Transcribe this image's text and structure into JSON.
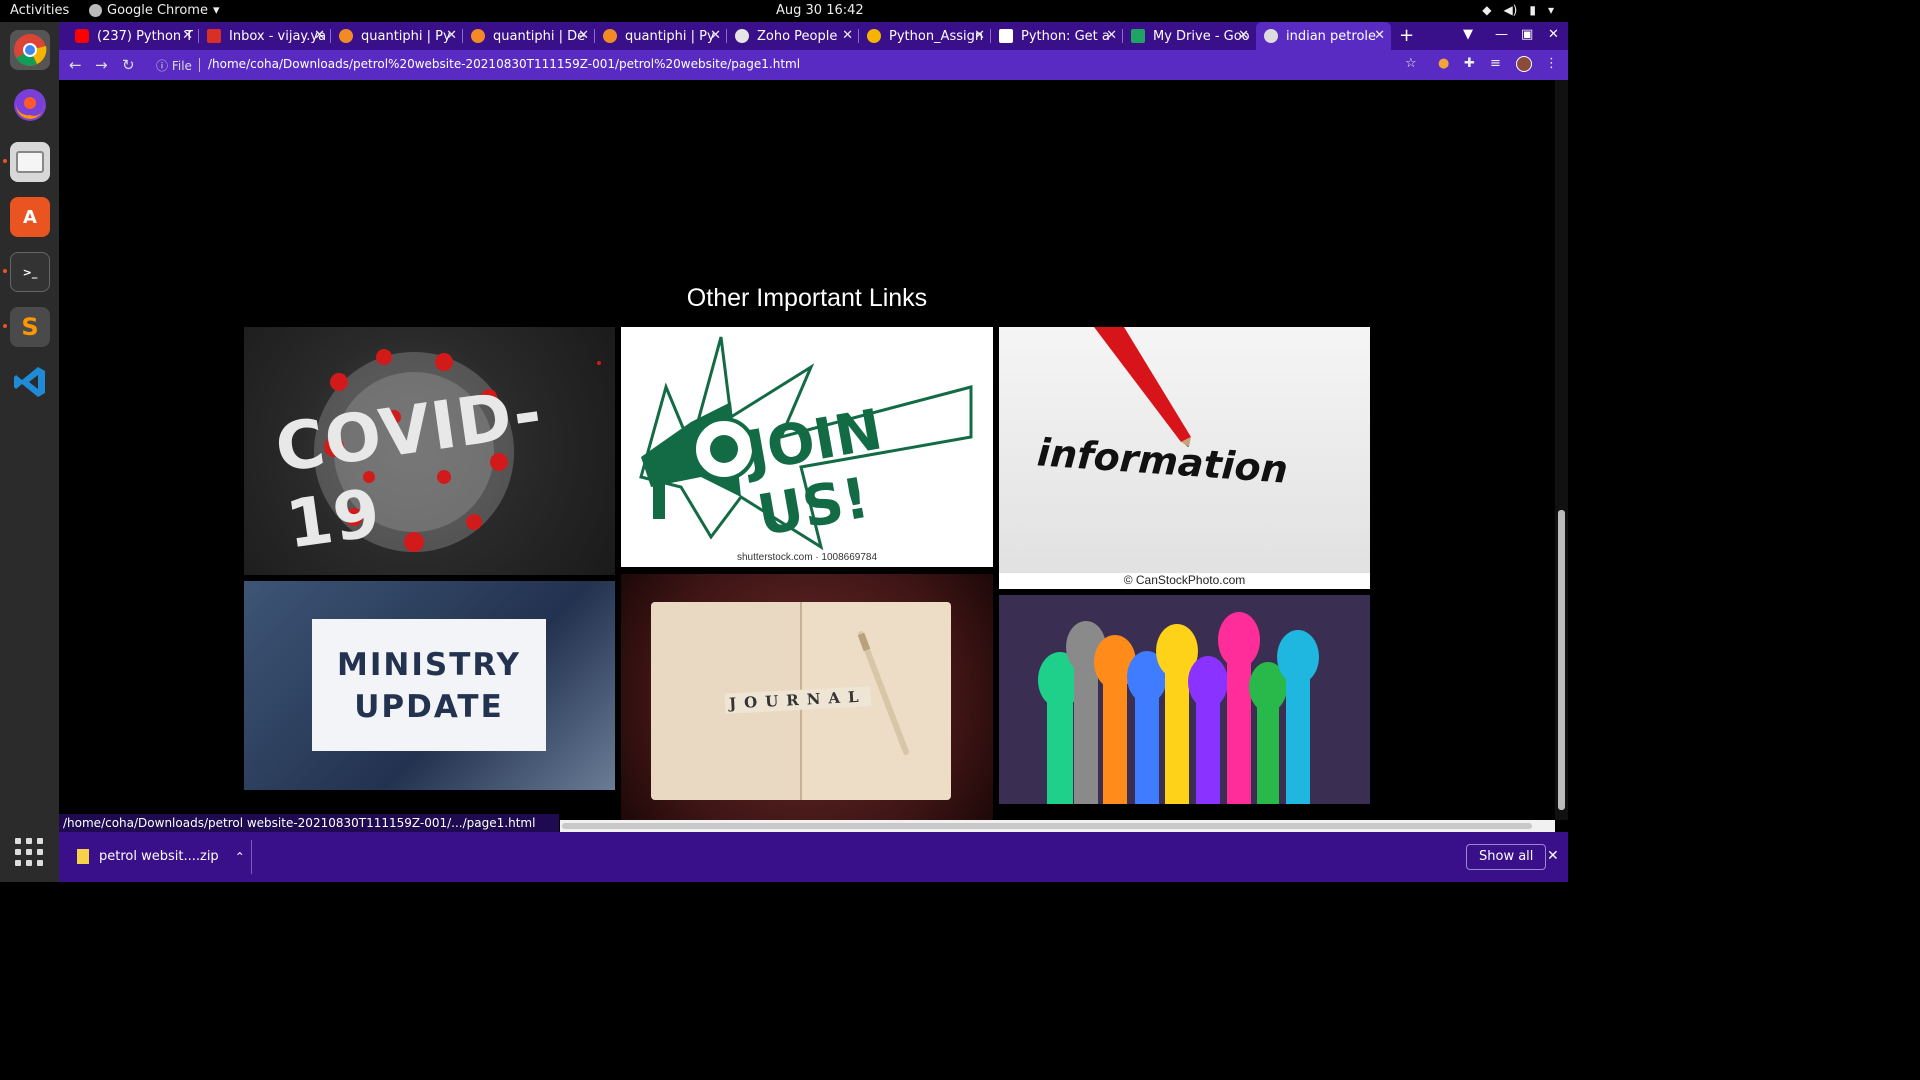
{
  "system": {
    "activities": "Activities",
    "app_name": "Google Chrome",
    "clock": "Aug 30  16:42"
  },
  "tabs": [
    {
      "title": "(237) Python T",
      "favicon_color": "#ff0000",
      "favicon": "youtube-icon"
    },
    {
      "title": "Inbox - vijay.ya",
      "favicon_color": "#d93025",
      "favicon": "gmail-icon"
    },
    {
      "title": "quantiphi | Py",
      "favicon_color": "#f28b25",
      "favicon": "quantiphi-icon"
    },
    {
      "title": "quantiphi | De",
      "favicon_color": "#f28b25",
      "favicon": "quantiphi-icon"
    },
    {
      "title": "quantiphi | Py",
      "favicon_color": "#f28b25",
      "favicon": "quantiphi-icon"
    },
    {
      "title": "Zoho People",
      "favicon_color": "#e5e5e5",
      "favicon": "zoho-icon"
    },
    {
      "title": "Python_Assign",
      "favicon_color": "#f4b400",
      "favicon": "colab-icon"
    },
    {
      "title": "Python: Get a",
      "favicon_color": "#ffffff",
      "favicon": "page-icon"
    },
    {
      "title": "My Drive - Goo",
      "favicon_color": "#1fa463",
      "favicon": "drive-icon"
    },
    {
      "title": "indian petrole",
      "favicon_color": "#dddddd",
      "favicon": "globe-icon"
    }
  ],
  "address": {
    "scheme_label": "File",
    "url": "/home/coha/Downloads/petrol%20website-20210830T111159Z-001/petrol%20website/page1.html"
  },
  "page": {
    "heading": "Other Important Links",
    "cards": [
      {
        "name": "covid-19",
        "caption": "COVID-19"
      },
      {
        "name": "join-us",
        "caption": "JOIN US!",
        "credit": "shutterstock.com · 1008669784"
      },
      {
        "name": "information",
        "caption": "information",
        "credit": "© CanStockPhoto.com"
      },
      {
        "name": "ministry-update",
        "caption_line1": "MINISTRY",
        "caption_line2": "UPDATE"
      },
      {
        "name": "journal",
        "caption": "JOURNAL"
      },
      {
        "name": "hands",
        "caption": ""
      }
    ]
  },
  "status_url": "/home/coha/Downloads/petrol website-20210830T111159Z-001/.../page1.html",
  "download": {
    "filename": "petrol websit....zip",
    "show_all": "Show all"
  },
  "colors": {
    "tabstrip": "#3a0f8a",
    "toolbar": "#5a2bc2",
    "page_bg": "#000000"
  }
}
